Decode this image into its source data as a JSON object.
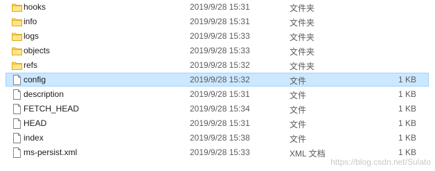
{
  "rows": [
    {
      "name": "hooks",
      "date": "2019/9/28 15:31",
      "type": "文件夹",
      "size": "",
      "icon": "folder-icon"
    },
    {
      "name": "info",
      "date": "2019/9/28 15:31",
      "type": "文件夹",
      "size": "",
      "icon": "folder-icon"
    },
    {
      "name": "logs",
      "date": "2019/9/28 15:33",
      "type": "文件夹",
      "size": "",
      "icon": "folder-icon"
    },
    {
      "name": "objects",
      "date": "2019/9/28 15:33",
      "type": "文件夹",
      "size": "",
      "icon": "folder-icon"
    },
    {
      "name": "refs",
      "date": "2019/9/28 15:32",
      "type": "文件夹",
      "size": "",
      "icon": "folder-icon"
    },
    {
      "name": "config",
      "date": "2019/9/28 15:32",
      "type": "文件",
      "size": "1 KB",
      "icon": "file-icon",
      "selected": true
    },
    {
      "name": "description",
      "date": "2019/9/28 15:31",
      "type": "文件",
      "size": "1 KB",
      "icon": "file-icon"
    },
    {
      "name": "FETCH_HEAD",
      "date": "2019/9/28 15:34",
      "type": "文件",
      "size": "1 KB",
      "icon": "file-icon"
    },
    {
      "name": "HEAD",
      "date": "2019/9/28 15:31",
      "type": "文件",
      "size": "1 KB",
      "icon": "file-icon"
    },
    {
      "name": "index",
      "date": "2019/9/28 15:38",
      "type": "文件",
      "size": "1 KB",
      "icon": "file-icon"
    },
    {
      "name": "ms-persist.xml",
      "date": "2019/9/28 15:33",
      "type": "XML 文档",
      "size": "1 KB",
      "icon": "file-icon"
    }
  ],
  "watermark": "https://blog.csdn.net/Sulato",
  "colors": {
    "selection_bg": "#cce8ff",
    "selection_border": "#99d1ff",
    "folder": "#f8d775",
    "folder_dark": "#e0a800"
  }
}
